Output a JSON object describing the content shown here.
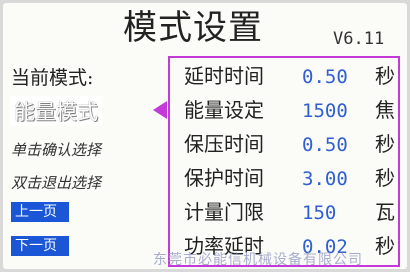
{
  "header": {
    "title": "模式设置",
    "version": "V6.11"
  },
  "left": {
    "current_mode_label": "当前模式:",
    "current_mode_value": "能量模式",
    "hint_single": "单击确认选择",
    "hint_double": "双击退出选择",
    "prev_page": "上一页",
    "next_page": "下一页"
  },
  "params": [
    {
      "name": "延时时间",
      "value": "0.50",
      "unit": "秒"
    },
    {
      "name": "能量设定",
      "value": "1500",
      "unit": "焦"
    },
    {
      "name": "保压时间",
      "value": "0.50",
      "unit": "秒"
    },
    {
      "name": "保护时间",
      "value": "3.00",
      "unit": "秒"
    },
    {
      "name": "计量门限",
      "value": "150",
      "unit": "瓦"
    },
    {
      "name": "功率延时",
      "value": "0.02",
      "unit": "秒"
    }
  ],
  "watermark": "东莞市必能信机械设备有限公司",
  "colors": {
    "accent": "#c43ad9",
    "value": "#2f5fd0",
    "button": "#1a56d6"
  }
}
